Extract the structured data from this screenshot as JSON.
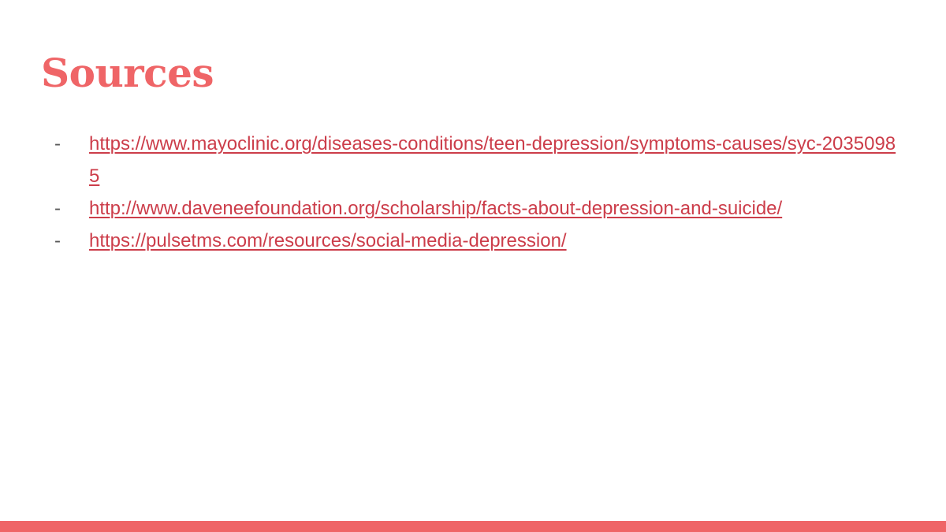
{
  "slide": {
    "title": "Sources",
    "bullet_char": "-",
    "sources": [
      {
        "url": "https://www.mayoclinic.org/diseases-conditions/teen-depression/symptoms-causes/syc-20350985"
      },
      {
        "url": "http://www.daveneefoundation.org/scholarship/facts-about-depression-and-suicide/"
      },
      {
        "url": "https://pulsetms.com/resources/social-media-depression/"
      }
    ]
  },
  "colors": {
    "title": "#ef6567",
    "link": "#cc3d4a",
    "bullet": "#595959",
    "accent_bar": "#ef6567",
    "background": "#ffffff"
  }
}
